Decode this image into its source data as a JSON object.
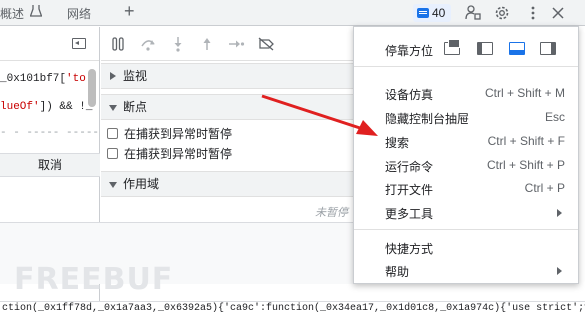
{
  "tabs": {
    "console": "概述",
    "network": "网络",
    "issues_count": "40"
  },
  "sources": {
    "code_line_1_prefix": "_0x101bf7[",
    "code_line_1_str": "'to",
    "code_line_2_str": "lueOf'",
    "code_line_2_rest": "]) && !_",
    "code_line_3": "- - -----  -----",
    "cancel_label": "取消"
  },
  "debugger": {
    "watch_label": "监视",
    "breakpoints_label": "断点",
    "pause_caught_label_1": "在捕获到异常时暂停",
    "pause_caught_label_2": "在捕获到异常时暂停",
    "scope_label": "作用域",
    "not_paused": "未暂停"
  },
  "menu": {
    "dock_label": "停靠方位",
    "items": [
      {
        "label": "设备仿真",
        "shortcut": "Ctrl + Shift + M"
      },
      {
        "label": "隐藏控制台抽屉",
        "shortcut": "Esc"
      },
      {
        "label": "搜索",
        "shortcut": "Ctrl + Shift + F"
      },
      {
        "label": "运行命令",
        "shortcut": "Ctrl + Shift + P"
      },
      {
        "label": "打开文件",
        "shortcut": "Ctrl + P"
      },
      {
        "label": "更多工具",
        "shortcut": ""
      },
      {
        "label": "快捷方式",
        "shortcut": ""
      },
      {
        "label": "帮助",
        "shortcut": ""
      }
    ]
  },
  "watermark": "FREEBUF",
  "bottom_code": "ction(_0x1ff78d,_0x1a7aa3,_0x6392a5){'ca9c':function(_0x34ea17,_0x1d01c8,_0x1a974c){'use strict';var",
  "icons": [
    "performance-icon",
    "plus-icon",
    "issues-icon",
    "people-icon",
    "gear-icon",
    "kebab-icon",
    "close-icon",
    "collapse-sidebar-icon",
    "pause-icon",
    "step-over-icon",
    "step-into-icon",
    "step-out-icon",
    "step-icon",
    "deactivate-breakpoints-icon",
    "dock-undock-icon",
    "dock-left-icon",
    "dock-bottom-icon",
    "dock-right-icon",
    "submenu-arrow-icon"
  ],
  "colors": {
    "accent": "#1a73e8",
    "annotation_arrow": "#e02020",
    "string_red": "#c80000"
  }
}
